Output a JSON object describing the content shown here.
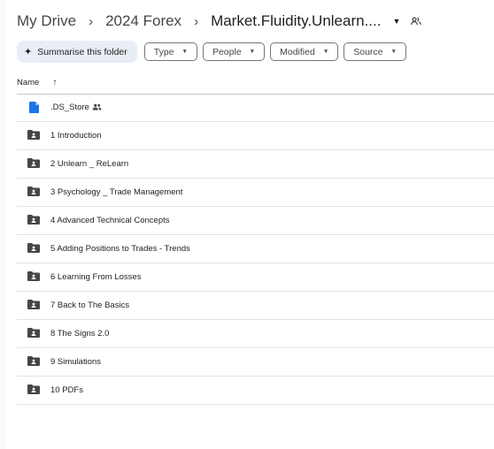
{
  "breadcrumb": {
    "items": [
      "My Drive",
      "2024 Forex",
      "Market.Fluidity.Unlearn...."
    ],
    "separator": "›"
  },
  "toolbar": {
    "summarise_label": "Summarise this folder",
    "filters": [
      "Type",
      "People",
      "Modified",
      "Source"
    ]
  },
  "table": {
    "name_header": "Name",
    "sort_arrow": "↑",
    "rows": [
      {
        "name": ".DS_Store",
        "icon": "file-icon",
        "shared": true
      },
      {
        "name": "1 Introduction",
        "icon": "shared-folder-icon"
      },
      {
        "name": "2 Unlearn _ ReLearn",
        "icon": "shared-folder-icon"
      },
      {
        "name": "3 Psychology _ Trade Management",
        "icon": "shared-folder-icon"
      },
      {
        "name": "4 Advanced Technical Concepts",
        "icon": "shared-folder-icon"
      },
      {
        "name": "5 Adding Positions to Trades - Trends",
        "icon": "shared-folder-icon"
      },
      {
        "name": "6 Learning From Losses",
        "icon": "shared-folder-icon"
      },
      {
        "name": "7 Back to The Basics",
        "icon": "shared-folder-icon"
      },
      {
        "name": "8 The Signs 2.0",
        "icon": "shared-folder-icon"
      },
      {
        "name": "9 Simulations",
        "icon": "shared-folder-icon"
      },
      {
        "name": "10 PDFs",
        "icon": "shared-folder-icon"
      }
    ]
  },
  "colors": {
    "file_icon": "#1a73e8",
    "folder_icon": "#444746",
    "summarise_bg": "#e9eef6"
  }
}
